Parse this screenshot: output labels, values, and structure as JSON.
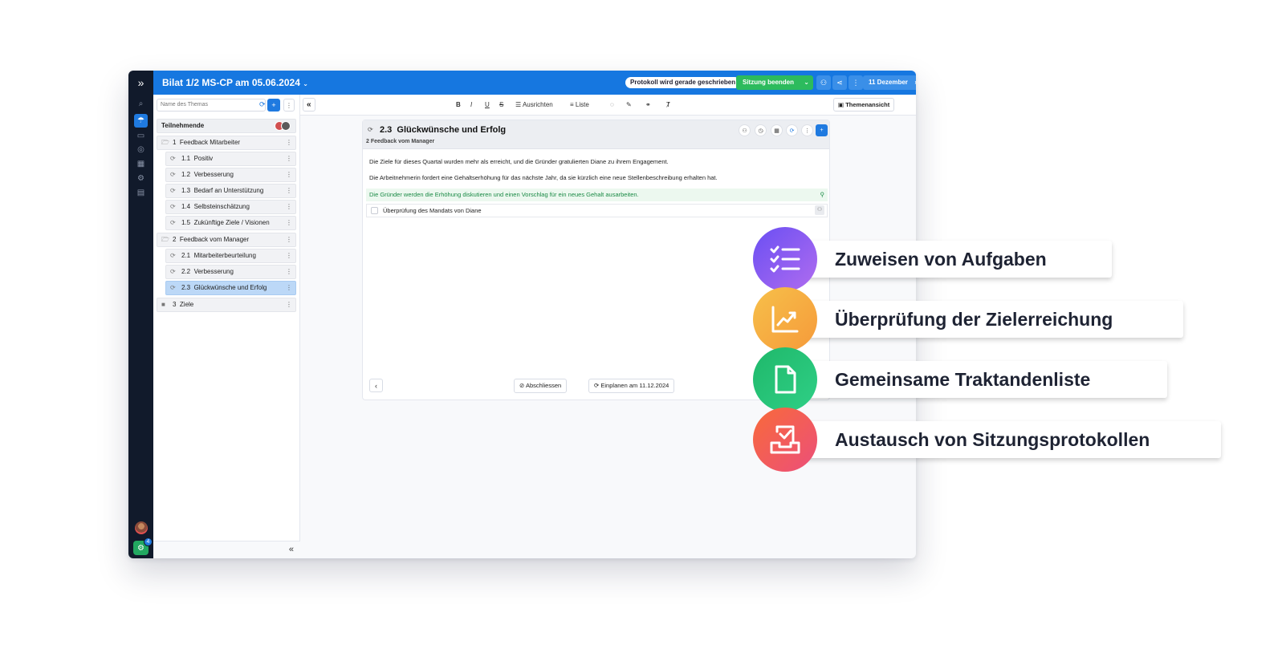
{
  "window": {
    "title": "Bilat 1/2 MS-CP am 05.06.2024",
    "status_badge": "Protokoll wird gerade geschrieben",
    "end_session_label": "Sitzung beenden",
    "date_nav_label": "11 Dezember"
  },
  "rail": {
    "notification_count": "4"
  },
  "sidebar": {
    "search_placeholder": "Name des Themas",
    "participants_label": "Teilnehmende",
    "items": [
      {
        "number": "1",
        "label": "Feedback Mitarbeiter",
        "type": "folder-open"
      },
      {
        "number": "1.1",
        "label": "Positiv",
        "type": "topic"
      },
      {
        "number": "1.2",
        "label": "Verbesserung",
        "type": "topic"
      },
      {
        "number": "1.3",
        "label": "Bedarf an Unterstützung",
        "type": "topic"
      },
      {
        "number": "1.4",
        "label": "Selbsteinschätzung",
        "type": "topic"
      },
      {
        "number": "1.5",
        "label": "Zukünftige Ziele / Visionen",
        "type": "topic"
      },
      {
        "number": "2",
        "label": "Feedback vom Manager",
        "type": "folder-open"
      },
      {
        "number": "2.1",
        "label": "Mitarbeiterbeurteilung",
        "type": "topic"
      },
      {
        "number": "2.2",
        "label": "Verbesserung",
        "type": "topic"
      },
      {
        "number": "2.3",
        "label": "Glückwünsche und Erfolg",
        "type": "topic",
        "selected": true
      },
      {
        "number": "3",
        "label": "Ziele",
        "type": "folder-closed"
      }
    ]
  },
  "toolbar": {
    "bold": "B",
    "italic": "I",
    "underline": "U",
    "strike": "S",
    "align_label": "Ausrichten",
    "list_label": "Liste",
    "topic_view_label": "Themenansicht"
  },
  "topic": {
    "number": "2.3",
    "title": "Glückwünsche und Erfolg",
    "parent": "2  Feedback vom Manager",
    "paragraphs": [
      "Die Ziele für dieses Quartal wurden mehr als erreicht, und die Gründer gratulierten Diane zu ihrem Engagement.",
      "Die Arbeitnehmerin fordert eine Gehaltserhöhung für das nächste Jahr, da sie kürzlich eine neue Stellenbeschreibung erhalten hat."
    ],
    "decision": "Die Gründer werden die Erhöhung diskutieren und einen Vorschlag für ein neues Gehalt ausarbeiten.",
    "task": "Überprüfung des Mandats von Diane",
    "close_label": "Abschliessen",
    "schedule_label": "Einplanen am 11.12.2024"
  },
  "features": [
    {
      "label": "Zuweisen von Aufgaben",
      "icon": "checklist-icon",
      "color_from": "#6a4ff2",
      "color_to": "#b06cf0"
    },
    {
      "label": "Überprüfung der Zielerreichung",
      "icon": "chart-icon",
      "color_from": "#f7c04a",
      "color_to": "#f59a3a"
    },
    {
      "label": "Gemeinsame Traktandenliste",
      "icon": "document-icon",
      "color_from": "#1fb86a",
      "color_to": "#2fcf86"
    },
    {
      "label": "Austausch von Sitzungsprotokollen",
      "icon": "inbox-icon",
      "color_from": "#f86a3a",
      "color_to": "#ec4f7a"
    }
  ]
}
